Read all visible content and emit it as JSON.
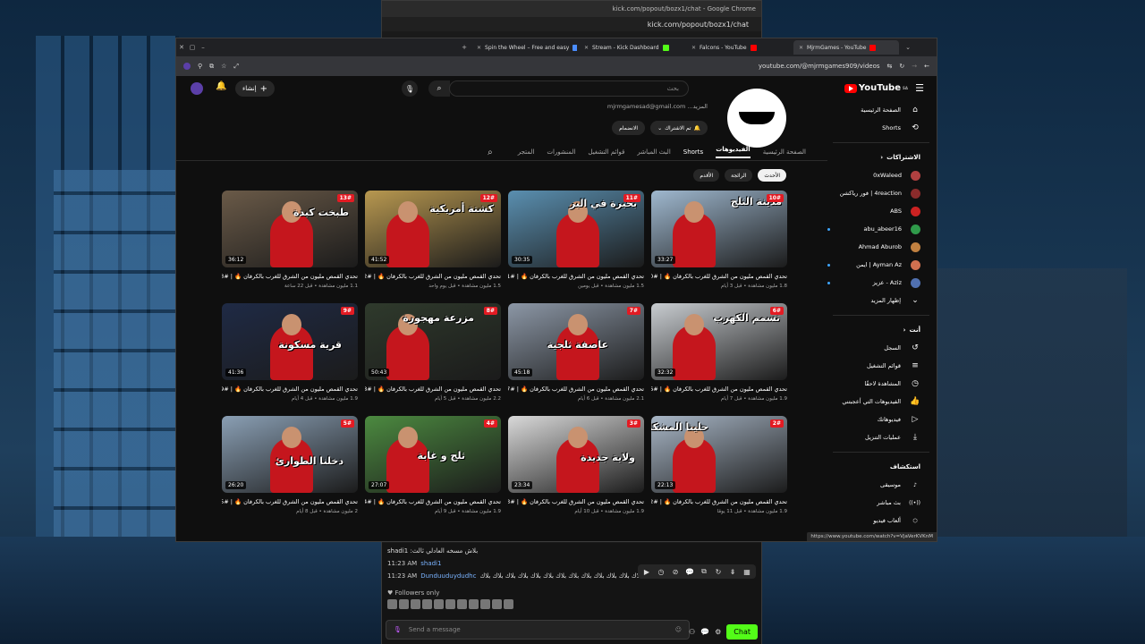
{
  "back_window": {
    "title": "kick.com/popout/bozx1/chat - Google Chrome",
    "url": "kick.com/popout/bozx1/chat"
  },
  "chat": {
    "lines": [
      {
        "time": "",
        "user": "",
        "text": "shadi1 :بلاش مسخه العادلي ثالث"
      },
      {
        "time": "11:23 AM",
        "user": "shadi1",
        "text": ""
      },
      {
        "time": "11:23 AM",
        "user": "Dunduuduydudhc",
        "text": "بلاك بلاك بلاك بلاك بلاك بلاك بلاك بلاك بلاك بلاك بلاك بلاك بلاك بلاك بلاك بلاك بلاك بلاك بلاك بلاك بلاك"
      }
    ],
    "followers_label": "Followers only",
    "input_placeholder": "Send a message",
    "send_label": "Chat",
    "toolbar": [
      "▶",
      "◷",
      "⊘",
      "💬",
      "⧉",
      "↻",
      "⇟",
      "▦"
    ]
  },
  "tabs": [
    {
      "label": "Spin the Wheel – Free and easy",
      "color": "#4a8dff"
    },
    {
      "label": "Stream - Kick Dashboard",
      "color": "#53fc18"
    },
    {
      "label": "Falcons - YouTube",
      "color": "#ff0000"
    },
    {
      "label": "MjrmGames - YouTube",
      "color": "#ff0000"
    }
  ],
  "address_url": "youtube.com/@mjrmgames909/videos",
  "yt": {
    "logo": "YouTube",
    "logo_region": "SA",
    "search_placeholder": "بحث",
    "create_label": "إنشاء"
  },
  "channel": {
    "email": "mjrmgamesad@gmail.com ...المزيد",
    "subscribe_label": "تم الاشتراك",
    "join_label": "الانضمام",
    "tabs": [
      "الصفحة الرئيسية",
      "الفيديوهات",
      "Shorts",
      "البث المباشر",
      "قوائم التشغيل",
      "المنشورات",
      "المتجر"
    ],
    "active_tab": "الفيديوهات",
    "chips": [
      "الأحدث",
      "الرائجة",
      "الأقدم"
    ]
  },
  "sidebar": {
    "top": [
      {
        "icon": "⌂",
        "name": "home-icon",
        "label": "الصفحة الرئيسية"
      },
      {
        "icon": "⟲",
        "name": "shorts-icon",
        "label": "Shorts"
      }
    ],
    "subs_header": "الاشتراكات",
    "subs": [
      {
        "label": "0xWaleed",
        "color": "#b04040",
        "live": false
      },
      {
        "label": "4reaction | فور رياكشن",
        "color": "#8a2b2b",
        "live": false
      },
      {
        "label": "ABS",
        "color": "#cc2222",
        "live": false
      },
      {
        "label": "abu_abeer16",
        "color": "#2f9a4a",
        "live": true
      },
      {
        "label": "Ahmad Aburob",
        "color": "#c08040",
        "live": false
      },
      {
        "label": "Ayman Az | ايمن",
        "color": "#d07050",
        "live": true
      },
      {
        "label": "Aziz - عزيز",
        "color": "#5070b0",
        "live": true
      }
    ],
    "show_more": "إظهار المزيد",
    "you_header": "أنت",
    "you": [
      {
        "icon": "↺",
        "name": "history-icon",
        "label": "السجل"
      },
      {
        "icon": "≡",
        "name": "playlists-icon",
        "label": "قوائم التشغيل"
      },
      {
        "icon": "◷",
        "name": "watch-later-icon",
        "label": "المشاهدة لاحقًا"
      },
      {
        "icon": "👍",
        "name": "like-icon",
        "label": "الفيديوهات التي أعجبتني"
      },
      {
        "icon": "▷",
        "name": "your-videos-icon",
        "label": "فيديوهاتك"
      },
      {
        "icon": "⤓",
        "name": "download-icon",
        "label": "عمليات التنزيل"
      }
    ],
    "explore_header": "استكشاف",
    "explore": [
      {
        "icon": "♪",
        "name": "music-icon",
        "label": "موسيقى"
      },
      {
        "icon": "((•))",
        "name": "live-icon",
        "label": "بث مباشر"
      },
      {
        "icon": "⬡",
        "name": "gaming-icon",
        "label": "ألعاب فيديو"
      }
    ]
  },
  "videos": [
    {
      "duration": "33:27",
      "ep": "10#",
      "caption": "مدينة الثلج",
      "bg": "#9fb8cf",
      "title": "تحدي القمص مليون من الشرق للغرب بالكرفان 🔥 | #10",
      "meta": "1.8 مليون مشاهدة • قبل 3 أيام"
    },
    {
      "duration": "30:35",
      "ep": "11#",
      "caption": "بحيرة في البر",
      "bg": "#5a8fb0",
      "title": "تحدي القمص مليون من الشرق للغرب بالكرفان 🔥 | #11",
      "meta": "1.5 مليون مشاهدة • قبل يومين"
    },
    {
      "duration": "41:52",
      "ep": "12#",
      "caption": "كشتة أمريكية",
      "bg": "#b89850",
      "title": "تحدي القمص مليون من الشرق للغرب بالكرفان 🔥 | #12",
      "meta": "1.5 مليون مشاهدة • قبل يوم واحد"
    },
    {
      "duration": "36:12",
      "ep": "13#",
      "caption": "طبخت كبدة",
      "bg": "#6a5a48",
      "title": "تحدي القمص مليون من الشرق للغرب بالكرفان 🔥 | #13",
      "meta": "1.1 مليون مشاهدة • قبل 22 ساعة"
    },
    {
      "duration": "32:32",
      "ep": "6#",
      "caption": "تسمم الكهرب",
      "bg": "#c8ccd0",
      "title": "تحدي القمص مليون من الشرق للغرب بالكرفان 🔥 | #6",
      "meta": "1.9 مليون مشاهدة • قبل 7 أيام"
    },
    {
      "duration": "45:18",
      "ep": "7#",
      "caption": "عاصفة ثلجية",
      "bg": "#8c97a6",
      "title": "تحدي القمص مليون من الشرق للغرب بالكرفان 🔥 | #7",
      "meta": "2.1 مليون مشاهدة • قبل 6 أيام"
    },
    {
      "duration": "50:43",
      "ep": "8#",
      "caption": "مزرعة مهجورة",
      "bg": "#2f3a2c",
      "title": "تحدي القمص مليون من الشرق للغرب بالكرفان 🔥 | #8",
      "meta": "2.2 مليون مشاهدة • قبل 5 أيام"
    },
    {
      "duration": "41:36",
      "ep": "9#",
      "caption": "قرية مسكونة",
      "bg": "#1f2a45",
      "title": "تحدي القمص مليون من الشرق للغرب بالكرفان 🔥 | #9",
      "meta": "1.9 مليون مشاهدة • قبل 4 أيام"
    },
    {
      "duration": "22:13",
      "ep": "2#",
      "caption": "حلينا المشكلة",
      "bg": "#a8b6c6",
      "title": "تحدي القمص مليون من الشرق للغرب بالكرفان 🔥 | #2",
      "meta": "1.9 مليون مشاهدة • قبل 11 يومًا"
    },
    {
      "duration": "23:34",
      "ep": "3#",
      "caption": "ولاية جديدة",
      "bg": "#d9d9d9",
      "title": "تحدي القمص مليون من الشرق للغرب بالكرفان 🔥 | #3",
      "meta": "1.9 مليون مشاهدة • قبل 10 أيام"
    },
    {
      "duration": "27:07",
      "ep": "4#",
      "caption": "ثلج و غابة",
      "bg": "#4c8a40",
      "title": "تحدي القمص مليون من الشرق للغرب بالكرفان 🔥 | #4",
      "meta": "1.9 مليون مشاهدة • قبل 9 أيام"
    },
    {
      "duration": "26:20",
      "ep": "5#",
      "caption": "دخلنا الطوارئ",
      "bg": "#8a9fb4",
      "title": "تحدي القمص مليون من الشرق للغرب بالكرفان 🔥 | #5",
      "meta": "2 مليون مشاهدة • قبل 8 أيام"
    }
  ],
  "status_url": "https://www.youtube.com/watch?v=VjaVerKVKnM"
}
